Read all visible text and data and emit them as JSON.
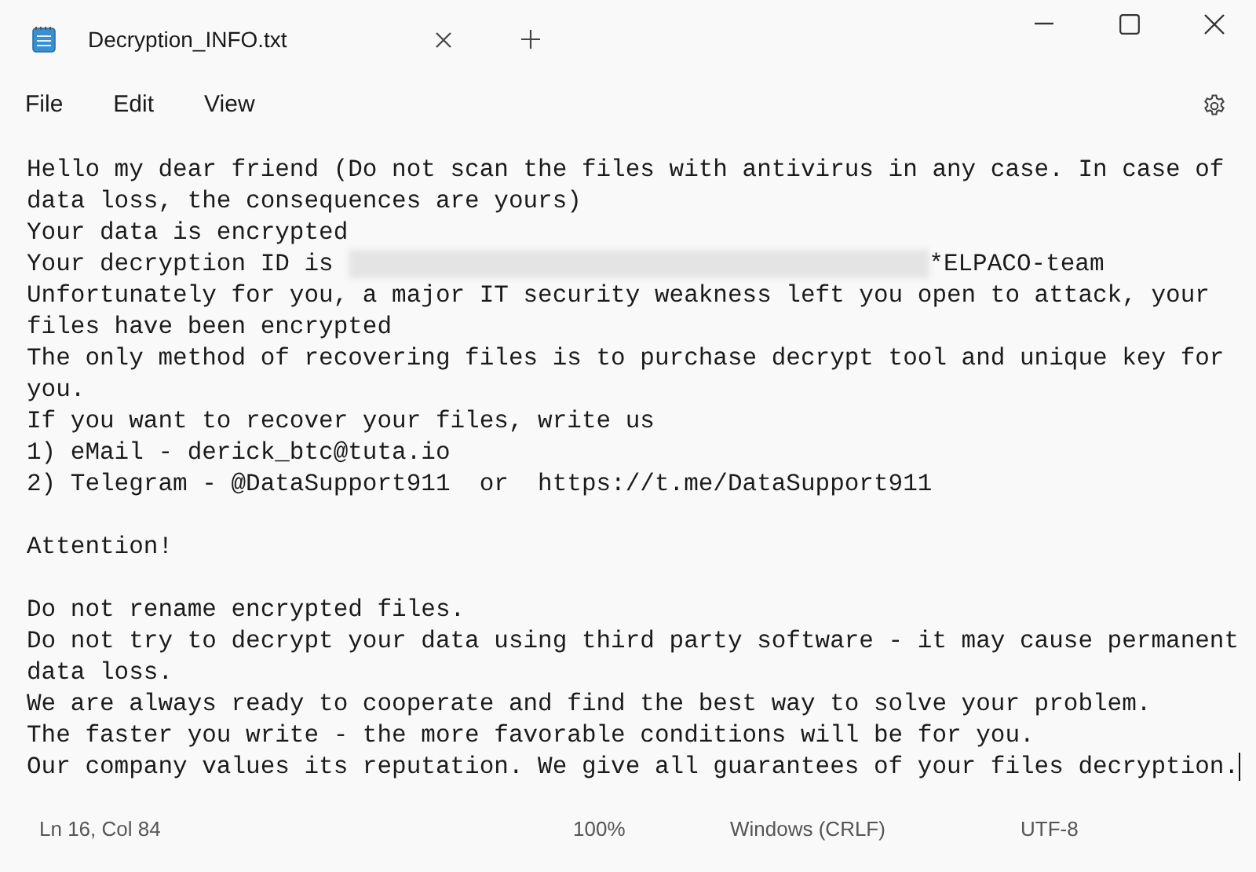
{
  "tab": {
    "title": "Decryption_INFO.txt"
  },
  "menu": [
    "File",
    "Edit",
    "View"
  ],
  "lines": [
    {
      "kind": "text",
      "text": "Hello my dear friend (Do not scan the files with antivirus in any case. In case of"
    },
    {
      "kind": "text",
      "text": "data loss, the consequences are yours)"
    },
    {
      "kind": "text",
      "text": "Your data is encrypted"
    },
    {
      "kind": "redacted",
      "prefix": "Your decryption ID is ",
      "suffix": "*ELPACO-team"
    },
    {
      "kind": "text",
      "text": "Unfortunately for you, a major IT security weakness left you open to attack, your"
    },
    {
      "kind": "text",
      "text": "files have been encrypted"
    },
    {
      "kind": "text",
      "text": "The only method of recovering files is to purchase decrypt tool and unique key for"
    },
    {
      "kind": "text",
      "text": "you."
    },
    {
      "kind": "text",
      "text": "If you want to recover your files, write us"
    },
    {
      "kind": "text",
      "text": "1) eMail - derick_btc@tuta.io"
    },
    {
      "kind": "text",
      "text": "2) Telegram - @DataSupport911  or  https://t.me/DataSupport911"
    },
    {
      "kind": "blank"
    },
    {
      "kind": "text",
      "text": "Attention!"
    },
    {
      "kind": "blank"
    },
    {
      "kind": "text",
      "text": "Do not rename encrypted files."
    },
    {
      "kind": "text",
      "text": "Do not try to decrypt your data using third party software - it may cause permanent"
    },
    {
      "kind": "text",
      "text": "data loss."
    },
    {
      "kind": "text",
      "text": "We are always ready to cooperate and find the best way to solve your problem."
    },
    {
      "kind": "text",
      "text": "The faster you write - the more favorable conditions will be for you."
    },
    {
      "kind": "text",
      "text": "Our company values its reputation. We give all guarantees of your files decryption.",
      "cursor": true
    }
  ],
  "status_bar": {
    "position": "Ln 16, Col 84",
    "zoom": "100%",
    "line_ending": "Windows (CRLF)",
    "encoding": "UTF-8"
  }
}
